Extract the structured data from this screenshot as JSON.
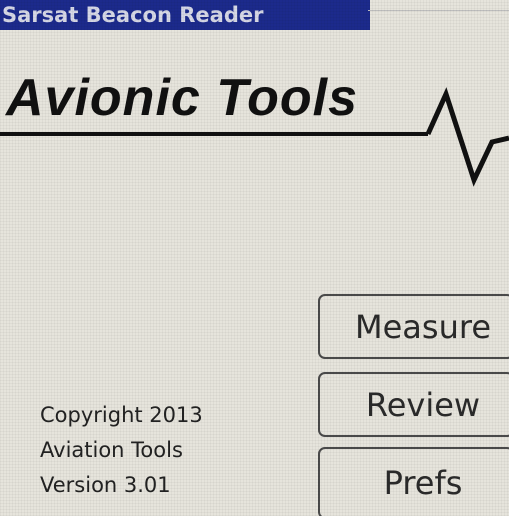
{
  "title_bar": "Sarsat Beacon Reader",
  "logo": {
    "text": "Avionic Tools"
  },
  "buttons": {
    "measure": "Measure",
    "review": "Review",
    "prefs": "Prefs"
  },
  "info": {
    "copyright": "Copyright 2013",
    "company": "Aviation Tools",
    "version": "Version 3.01"
  },
  "colors": {
    "title_bar_bg": "#1c2a8c",
    "screen_bg": "#e6e4dc"
  }
}
